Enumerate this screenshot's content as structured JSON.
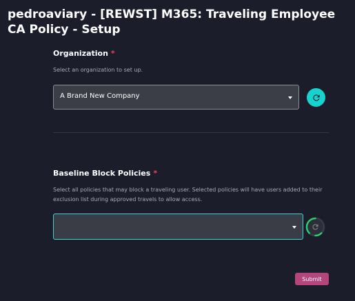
{
  "page": {
    "title": "pedroaviary - [REWST] M365: Traveling Employee CA Policy - Setup"
  },
  "organization": {
    "label": "Organization",
    "required_marker": "*",
    "help_text": "Select an organization to set up.",
    "selected_value": "A Brand New Company",
    "refresh_icon": "refresh-icon"
  },
  "baseline_block_policies": {
    "label": "Baseline Block Policies",
    "required_marker": "*",
    "help_text": "Select all policies that may block a traveling user. Selected policies will have users added to their exclusion list during approved travels to allow access.",
    "selected_value": "",
    "refresh_icon": "refresh-icon",
    "loading": true
  },
  "submit": {
    "label": "Submit"
  },
  "colors": {
    "background": "#1b1d2b",
    "accent_teal": "#17d3d0",
    "required_red": "#e0464f",
    "submit_pink": "#b5457d",
    "focus_border": "#3ed6d3"
  }
}
